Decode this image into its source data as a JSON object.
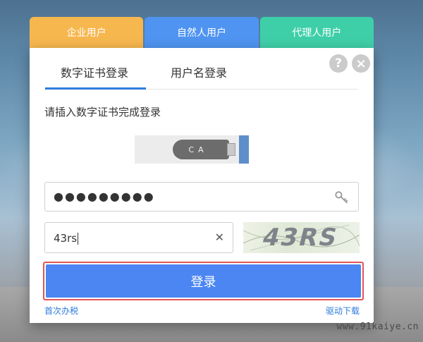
{
  "user_type_tabs": {
    "enterprise": "企业用户",
    "natural": "自然人用户",
    "agent": "代理人用户"
  },
  "login_tabs": {
    "cert": "数字证书登录",
    "username": "用户名登录"
  },
  "help_icon": "?",
  "close_icon": "×",
  "prompt": "请插入数字证书完成登录",
  "ca_label": "CA",
  "password": {
    "value": "●●●●●●●●●"
  },
  "captcha": {
    "value": "43rs",
    "clear_icon": "✕",
    "image_text": "43RS"
  },
  "login_button": "登录",
  "links": {
    "first_time": "首次办税",
    "driver": "驱动下载"
  },
  "watermark": "www.91kaiye.cn",
  "colors": {
    "enterprise_tab": "#f7b74f",
    "natural_tab": "#4f94f1",
    "agent_tab": "#3fcfa8",
    "login_button": "#4b86f2",
    "highlight_outline": "#e25456",
    "link": "#2f7cdc"
  },
  "icons": [
    "help-icon",
    "close-icon",
    "ca-usb-icon",
    "key-icon",
    "clear-icon"
  ]
}
